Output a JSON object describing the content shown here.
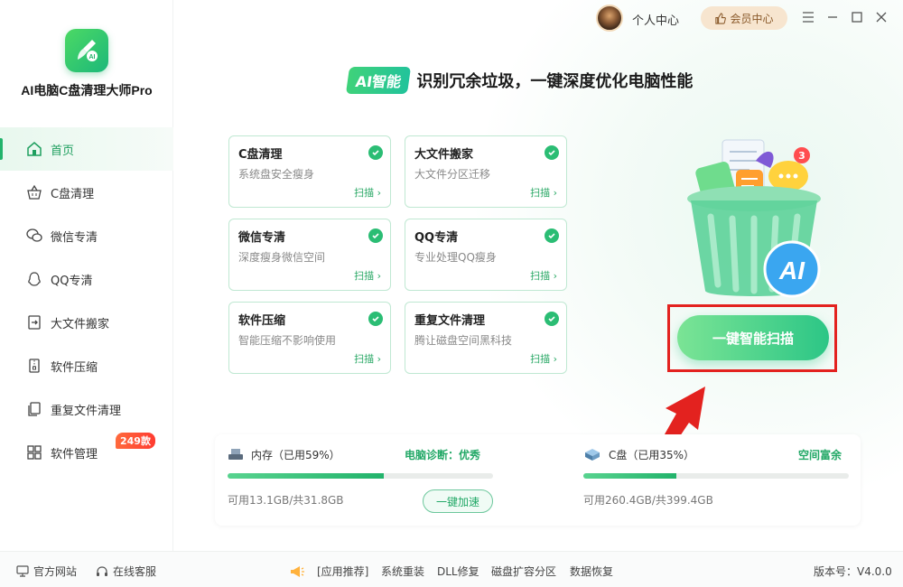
{
  "app": {
    "title": "AI电脑C盘清理大师Pro"
  },
  "sidebar": {
    "items": [
      {
        "label": "首页",
        "icon": "home-icon",
        "active": true
      },
      {
        "label": "C盘清理",
        "icon": "basket-icon"
      },
      {
        "label": "微信专清",
        "icon": "wechat-icon"
      },
      {
        "label": "QQ专清",
        "icon": "qq-icon"
      },
      {
        "label": "大文件搬家",
        "icon": "move-file-icon"
      },
      {
        "label": "软件压缩",
        "icon": "zip-icon"
      },
      {
        "label": "重复文件清理",
        "icon": "duplicate-file-icon"
      },
      {
        "label": "软件管理",
        "icon": "apps-icon",
        "badge": "249款"
      }
    ]
  },
  "topbar": {
    "personal": "个人中心",
    "vip": "会员中心"
  },
  "headline": {
    "pill": "AI智能",
    "text": "识别冗余垃圾，一键深度优化电脑性能"
  },
  "cards": [
    {
      "title": "C盘清理",
      "desc": "系统盘安全瘦身",
      "action": "扫描 ›"
    },
    {
      "title": "大文件搬家",
      "desc": "大文件分区迁移",
      "action": "扫描 ›"
    },
    {
      "title": "微信专清",
      "desc": "深度瘦身微信空间",
      "action": "扫描 ›"
    },
    {
      "title": "QQ专清",
      "desc": "专业处理QQ瘦身",
      "action": "扫描 ›"
    },
    {
      "title": "软件压缩",
      "desc": "智能压缩不影响使用",
      "action": "扫描 ›"
    },
    {
      "title": "重复文件清理",
      "desc": "腾让磁盘空间黑科技",
      "action": "扫描 ›"
    }
  ],
  "scan_button": "一键智能扫描",
  "bin_badge": "3",
  "bin_ai": "AI",
  "status": {
    "memory": {
      "label": "内存（已用59%）",
      "diagnosis": "电脑诊断：优秀",
      "used_percent": 59,
      "capacity": "可用13.1GB/共31.8GB",
      "action": "一键加速"
    },
    "disk": {
      "label": "C盘（已用35%）",
      "diagnosis": "空间富余",
      "used_percent": 35,
      "capacity": "可用260.4GB/共399.4GB"
    }
  },
  "footer": {
    "website": "官方网站",
    "service": "在线客服",
    "recommend": "[应用推荐]",
    "links": [
      "系统重装",
      "DLL修复",
      "磁盘扩容分区",
      "数据恢复"
    ],
    "version": "版本号：V4.0.0"
  },
  "colors": {
    "accent": "#22b36b",
    "highlight_box": "#e3221f",
    "vip": "#f7e5cf"
  }
}
